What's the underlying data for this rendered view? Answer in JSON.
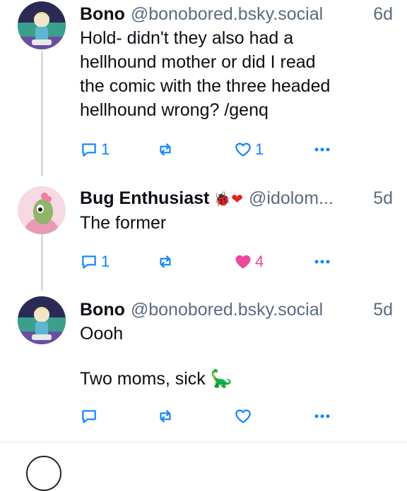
{
  "posts": [
    {
      "author": "Bono",
      "handle": "@bonobored.bsky.social",
      "time": "6d",
      "text": [
        "Hold- didn't they also had a",
        "hellhound mother or did I read",
        "the comic with the three headed",
        "hellhound wrong? /genq"
      ],
      "replies": "1",
      "reposts": "",
      "likes": "1"
    },
    {
      "author": "Bug Enthusiast",
      "author_emoji": "🐞❤",
      "handle": "@idolom...",
      "time": "5d",
      "text": [
        "The former"
      ],
      "replies": "1",
      "reposts": "",
      "likes": "4",
      "liked": true
    },
    {
      "author": "Bono",
      "handle": "@bonobored.bsky.social",
      "time": "5d",
      "text": [
        "Oooh",
        "Two moms, sick 🦕"
      ],
      "replies": "",
      "reposts": "",
      "likes": ""
    }
  ],
  "icons": {
    "reply": "reply-icon",
    "repost": "repost-icon",
    "like": "heart-icon",
    "more": "more-icon"
  },
  "colors": {
    "accent_like": "#ec4899",
    "muted": "#5a6b7e",
    "link": "#1083fe"
  }
}
